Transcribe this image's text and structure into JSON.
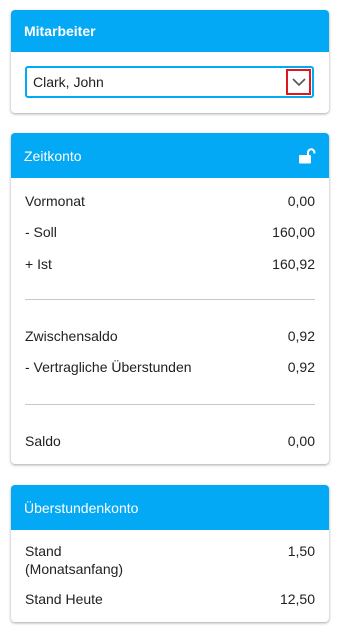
{
  "employee": {
    "title": "Mitarbeiter",
    "selected": "Clark, John",
    "dropdown_icon": "chevron-down-icon"
  },
  "zeitkonto": {
    "title": "Zeitkonto",
    "lock_icon": "unlock-icon",
    "rows": [
      {
        "label": "Vormonat",
        "value": "0,00"
      },
      {
        "label": "- Soll",
        "value": "160,00"
      },
      {
        "label": "+ Ist",
        "value": "160,92"
      },
      {
        "label": "Zwischensaldo",
        "value": "0,92"
      },
      {
        "label": "- Vertragliche Überstunden",
        "value": "0,92"
      },
      {
        "label": "Saldo",
        "value": "0,00"
      }
    ]
  },
  "ueberstundenkonto": {
    "title": "Überstundenkonto",
    "rows": [
      {
        "label": "Stand\n(Monatsanfang)",
        "value": "1,50"
      },
      {
        "label": "Stand Heute",
        "value": "12,50"
      }
    ]
  },
  "colors": {
    "accent": "#03a9f4",
    "highlight": "#e0161e"
  }
}
